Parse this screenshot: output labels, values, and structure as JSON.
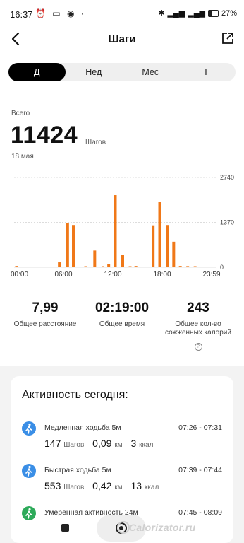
{
  "status_bar": {
    "time": "16:37",
    "battery": "27%"
  },
  "header": {
    "title": "Шаги"
  },
  "period_tabs": [
    {
      "label": "Д",
      "active": true
    },
    {
      "label": "Нед",
      "active": false
    },
    {
      "label": "Мес",
      "active": false
    },
    {
      "label": "Г",
      "active": false
    }
  ],
  "summary": {
    "total_label": "Всего",
    "steps": "11424",
    "unit": "Шагов",
    "date": "18 мая"
  },
  "chart_data": {
    "type": "bar",
    "x_tick_labels": [
      "00:00",
      "06:00",
      "12:00",
      "18:00",
      "23:59"
    ],
    "y_tick_labels": [
      "2740",
      "1370",
      "0"
    ],
    "ylim": [
      0,
      2740
    ],
    "bar_color": "#f07818",
    "bars": [
      {
        "hour": 0.3,
        "value": 40
      },
      {
        "hour": 5.5,
        "value": 150
      },
      {
        "hour": 6.5,
        "value": 1340
      },
      {
        "hour": 7.2,
        "value": 1290
      },
      {
        "hour": 8.7,
        "value": 25
      },
      {
        "hour": 9.8,
        "value": 510
      },
      {
        "hour": 10.8,
        "value": 30
      },
      {
        "hour": 11.5,
        "value": 90
      },
      {
        "hour": 12.3,
        "value": 2200
      },
      {
        "hour": 13.2,
        "value": 370
      },
      {
        "hour": 14.1,
        "value": 20
      },
      {
        "hour": 14.8,
        "value": 40
      },
      {
        "hour": 16.9,
        "value": 1280
      },
      {
        "hour": 17.7,
        "value": 2000
      },
      {
        "hour": 18.6,
        "value": 1290
      },
      {
        "hour": 19.4,
        "value": 780
      },
      {
        "hour": 20.2,
        "value": 40
      },
      {
        "hour": 21.1,
        "value": 35
      },
      {
        "hour": 22.0,
        "value": 30
      }
    ]
  },
  "stats": [
    {
      "value": "7,99",
      "label": "Общее расстояние"
    },
    {
      "value": "02:19:00",
      "label": "Общее время"
    },
    {
      "value": "243",
      "label": "Общее кол-во сожженных калорий"
    }
  ],
  "activity": {
    "title": "Активность сегодня:",
    "items": [
      {
        "name": "Медленная ходьба 5м",
        "time": "07:26 - 07:31",
        "steps": "147",
        "steps_unit": "Шагов",
        "distance": "0,09",
        "distance_unit": "км",
        "calories": "3",
        "calories_unit": "ккал",
        "icon_color": "#3a8ee6"
      },
      {
        "name": "Быстрая ходьба 5м",
        "time": "07:39 - 07:44",
        "steps": "553",
        "steps_unit": "Шагов",
        "distance": "0,42",
        "distance_unit": "км",
        "calories": "13",
        "calories_unit": "ккал",
        "icon_color": "#3a8ee6"
      },
      {
        "name": "Умеренная активность 24м",
        "time": "07:45 - 08:09",
        "icon_color": "#2eaa5a"
      }
    ]
  },
  "watermark": "Calorizator.ru"
}
